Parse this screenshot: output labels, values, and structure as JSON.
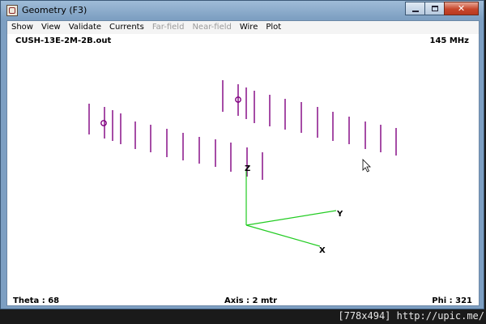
{
  "window": {
    "title": "Geometry  (F3)",
    "app_icon": "geometry-app-icon"
  },
  "menu": [
    {
      "label": "Show",
      "enabled": true
    },
    {
      "label": "View",
      "enabled": true
    },
    {
      "label": "Validate",
      "enabled": true
    },
    {
      "label": "Currents",
      "enabled": true
    },
    {
      "label": "Far-field",
      "enabled": false
    },
    {
      "label": "Near-field",
      "enabled": false
    },
    {
      "label": "Wire",
      "enabled": true
    },
    {
      "label": "Plot",
      "enabled": true
    }
  ],
  "header": {
    "file_name": "CUSH-13E-2M-2B.out",
    "frequency": "145 MHz"
  },
  "axes": {
    "z": "Z",
    "y": "Y",
    "x": "X"
  },
  "status": {
    "theta": "Theta : 68",
    "axis": "Axis : 2 mtr",
    "phi": "Phi : 321"
  },
  "watermark": "[778x494] http://upic.me/",
  "colors": {
    "wire": "#800080",
    "axis": "#22cc22",
    "accent": "#7d9fc2"
  }
}
